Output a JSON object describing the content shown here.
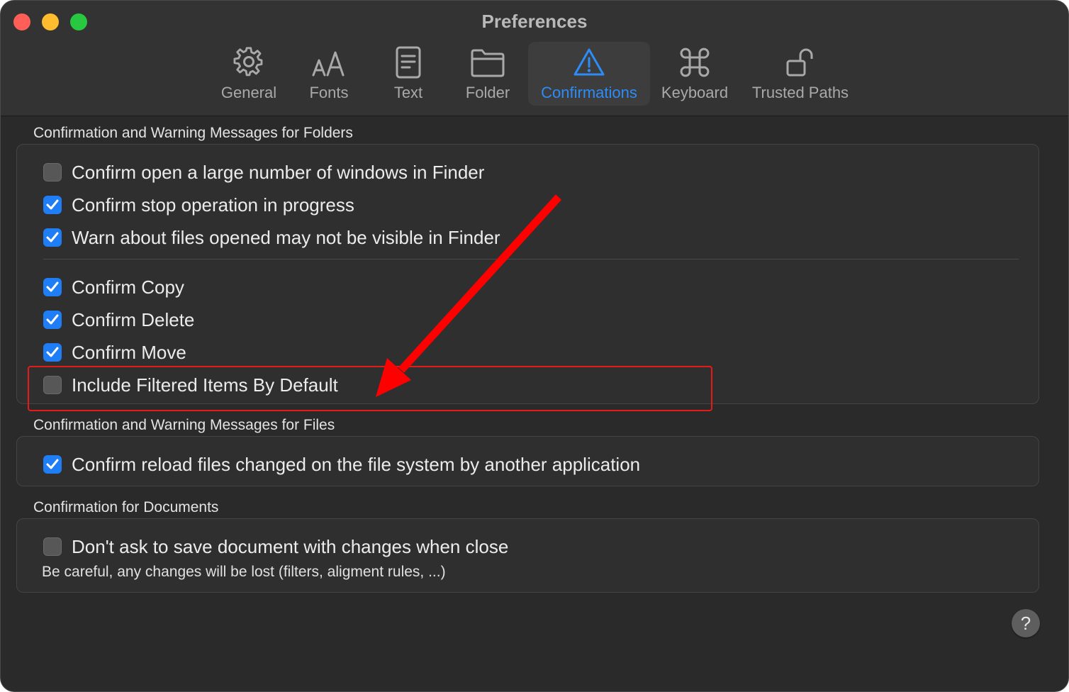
{
  "window": {
    "title": "Preferences"
  },
  "tabs": [
    {
      "label": "General",
      "icon": "gear-icon",
      "active": false
    },
    {
      "label": "Fonts",
      "icon": "fonts-icon",
      "active": false
    },
    {
      "label": "Text",
      "icon": "document-icon",
      "active": false
    },
    {
      "label": "Folder",
      "icon": "folder-icon",
      "active": false
    },
    {
      "label": "Confirmations",
      "icon": "warning-icon",
      "active": true
    },
    {
      "label": "Keyboard",
      "icon": "command-icon",
      "active": false
    },
    {
      "label": "Trusted Paths",
      "icon": "unlock-icon",
      "active": false
    }
  ],
  "sections": {
    "folders": {
      "title": "Confirmation and Warning Messages for Folders",
      "options": [
        {
          "label": "Confirm open a large number of windows in Finder",
          "checked": false
        },
        {
          "label": "Confirm stop operation in progress",
          "checked": true
        },
        {
          "label": "Warn about files opened may not be visible in Finder",
          "checked": true
        },
        {
          "label": "Confirm Copy",
          "checked": true
        },
        {
          "label": "Confirm Delete",
          "checked": true
        },
        {
          "label": "Confirm Move",
          "checked": true
        },
        {
          "label": "Include Filtered Items By Default",
          "checked": false
        }
      ]
    },
    "files": {
      "title": "Confirmation and Warning Messages for Files",
      "options": [
        {
          "label": "Confirm reload files changed on the file system by another application",
          "checked": true
        }
      ]
    },
    "documents": {
      "title": "Confirmation for Documents",
      "options": [
        {
          "label": "Don't ask to save document with changes when close",
          "checked": false
        }
      ],
      "note": "Be careful, any changes will be lost (filters, aligment rules, ...)"
    }
  },
  "help": {
    "label": "?"
  },
  "colors": {
    "accent": "#1f7ef5",
    "annotation": "#e41b1b",
    "background": "#2a2a2a"
  }
}
